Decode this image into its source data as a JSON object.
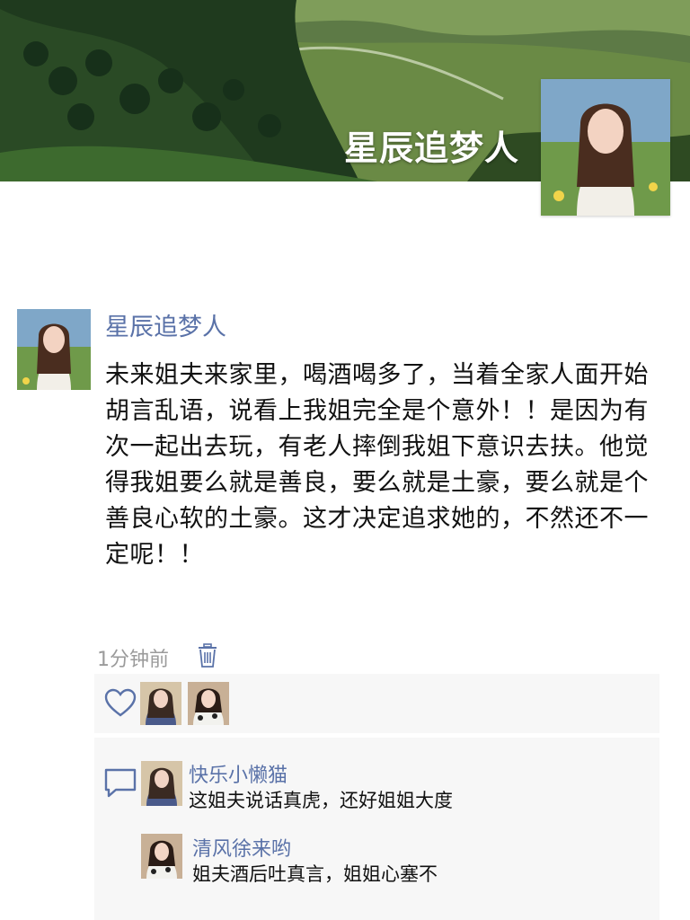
{
  "profile": {
    "display_name": "星辰追梦人"
  },
  "post": {
    "author": "星辰追梦人",
    "text": "未来姐夫来家里，喝酒喝多了，当着全家人面开始胡言乱语，说看上我姐完全是个意外！！是因为有次一起出去玩，有老人摔倒我姐下意识去扶。他觉得我姐要么就是善良，要么就是土豪，要么就是个善良心软的土豪。这才决定追求她的，不然还不一定呢！！",
    "time": "1分钟前"
  },
  "likes": {
    "icon": "heart-icon",
    "count": 2
  },
  "comments": [
    {
      "name": "快乐小懒猫",
      "text": "这姐夫说话真虎，还好姐姐大度"
    },
    {
      "name": "清风徐来哟",
      "text": "姐夫酒后吐真言，姐姐心塞不"
    }
  ],
  "colors": {
    "link": "#5a72a8",
    "panel": "#f7f7f7",
    "meta": "#9b9b9b"
  }
}
